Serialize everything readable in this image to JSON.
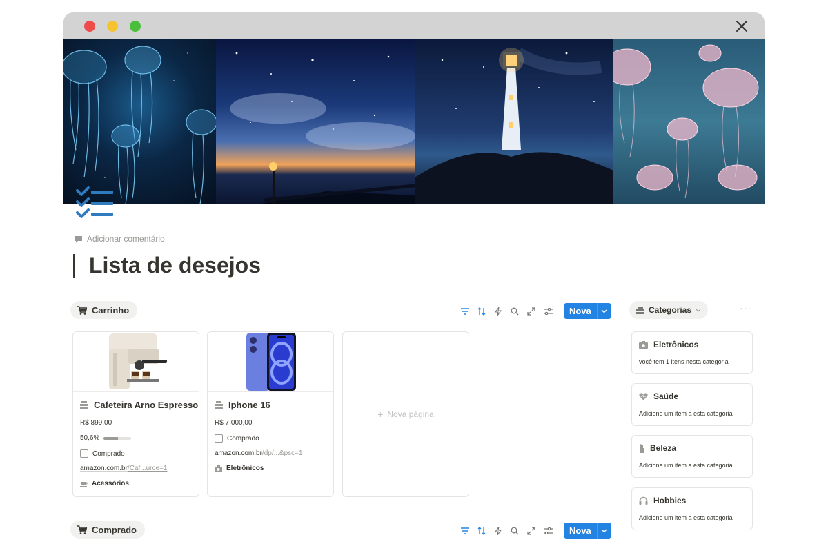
{
  "page": {
    "title": "Lista de desejos",
    "add_comment": "Adicionar comentário",
    "page_icon": "checklist-icon"
  },
  "cover": {
    "panels": [
      "jellyfish",
      "starry-sky-pier",
      "lighthouse-night",
      "pink-jellyfish"
    ]
  },
  "views": {
    "carrinho": {
      "label": "Carrinho",
      "icon": "cart-icon"
    },
    "comprado": {
      "label": "Comprado",
      "icon": "cart-icon"
    }
  },
  "toolbar": {
    "icons": [
      "filter-icon",
      "sort-icon",
      "automation-icon",
      "search-icon",
      "expand-icon",
      "settings-icon"
    ],
    "new_label": "Nova",
    "accent": "#2383e2"
  },
  "cards": [
    {
      "title": "Cafeteira Arno Espresso",
      "price": "R$ 899,00",
      "progress_text": "50,6%",
      "progress": 0.506,
      "purchased_label": "Comprado",
      "url_main": "amazon.com.br",
      "url_rest": "/Caf...urce=1",
      "category": "Acessórios",
      "category_icon": "coffee-icon"
    },
    {
      "title": "Iphone 16",
      "price": "R$ 7.000,00",
      "purchased_label": "Comprado",
      "url_main": "amazon.com.br",
      "url_rest": "/dp/...&psc=1",
      "category": "Eletrônicos",
      "category_icon": "camera-icon"
    }
  ],
  "new_page_label": "Nova página",
  "categories": {
    "label": "Categorias",
    "more": "···",
    "items": [
      {
        "name": "Eletrônicos",
        "desc": "você tem 1 itens nesta categoria",
        "icon": "camera-icon"
      },
      {
        "name": "Saúde",
        "desc": "Adicione um item a esta categoria",
        "icon": "heart-icon"
      },
      {
        "name": "Beleza",
        "desc": "Adicione um item a esta categoria",
        "icon": "lipstick-icon"
      },
      {
        "name": "Hobbies",
        "desc": "Adicione um item a esta categoria",
        "icon": "headphones-icon"
      }
    ]
  }
}
